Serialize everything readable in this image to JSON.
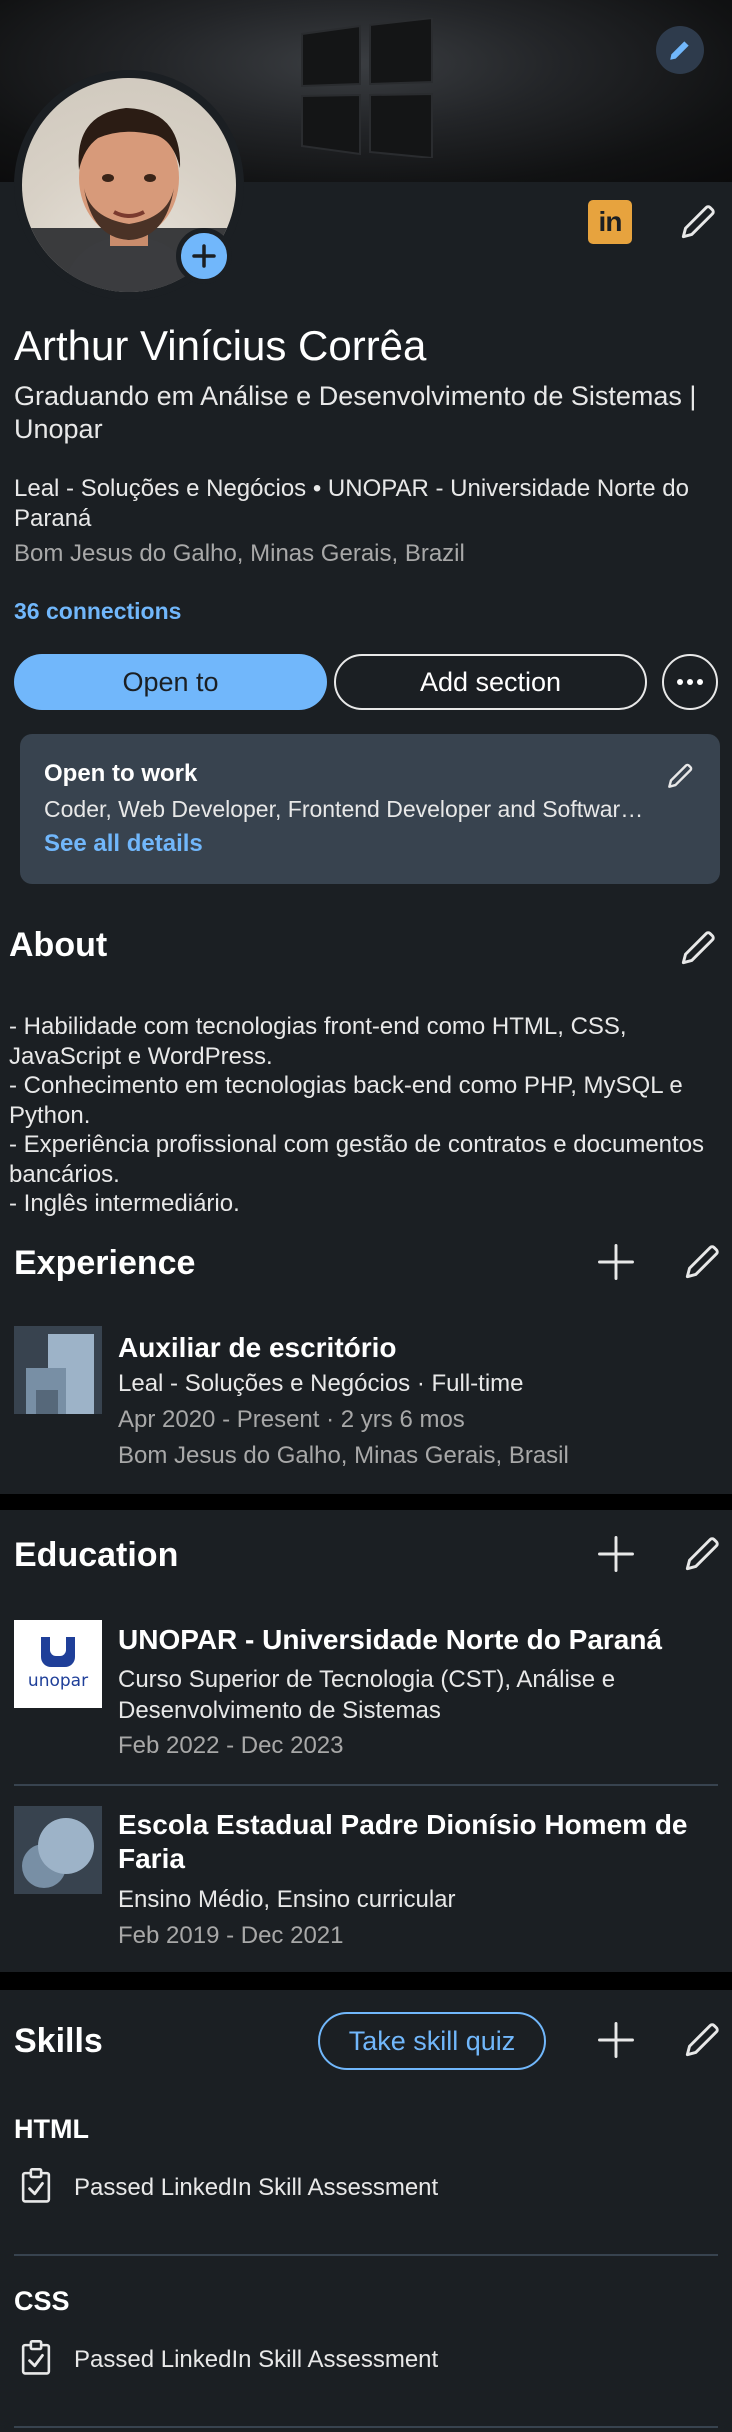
{
  "header": {
    "name": "Arthur Vinícius Corrêa",
    "headline": "Graduando em Análise e Desenvolvimento de Sistemas | Unopar",
    "current_positions": "Leal - Soluções e Negócios • UNOPAR - Universidade Norte do Paraná",
    "location": "Bom Jesus do Galho, Minas Gerais, Brazil",
    "connections": "36 connections",
    "linkedin_badge": "in"
  },
  "actions": {
    "open_to": "Open to",
    "add_section": "Add section",
    "more": "more-horizontal-icon"
  },
  "open_to_work": {
    "title": "Open to work",
    "roles": "Coder, Web Developer, Frontend Developer and Software Developer roles",
    "link": "See all details"
  },
  "about": {
    "title": "About",
    "text": "- Habilidade com tecnologias front-end como HTML, CSS, JavaScript e WordPress.\n- Conhecimento em tecnologias back-end como PHP, MySQL e Python.\n- Experiência profissional com gestão de contratos e documentos bancários.\n- Inglês intermediário."
  },
  "experience": {
    "title": "Experience",
    "items": [
      {
        "role": "Auxiliar de escritório",
        "company": "Leal - Soluções e Negócios · Full-time",
        "dates": "Apr 2020 - Present · 2 yrs 6 mos",
        "location": "Bom Jesus do Galho, Minas Gerais, Brasil"
      }
    ]
  },
  "education": {
    "title": "Education",
    "items": [
      {
        "school": "UNOPAR - Universidade Norte do Paraná",
        "degree": "Curso Superior de Tecnologia (CST), Análise e Desenvolvimento de Sistemas",
        "dates": "Feb 2022 - Dec 2023",
        "logo_text": "unopar"
      },
      {
        "school": "Escola Estadual Padre Dionísio Homem de Faria",
        "degree": "Ensino Médio, Ensino curricular",
        "dates": "Feb 2019 - Dec 2021"
      }
    ]
  },
  "skills": {
    "title": "Skills",
    "quiz_button": "Take skill quiz",
    "items": [
      {
        "name": "HTML",
        "assessment": "Passed LinkedIn Skill Assessment"
      },
      {
        "name": "CSS",
        "assessment": "Passed LinkedIn Skill Assessment"
      }
    ]
  },
  "colors": {
    "background": "#1b1f23",
    "accent": "#71b7fb",
    "card": "#38434f",
    "badge": "#e7a33e"
  }
}
